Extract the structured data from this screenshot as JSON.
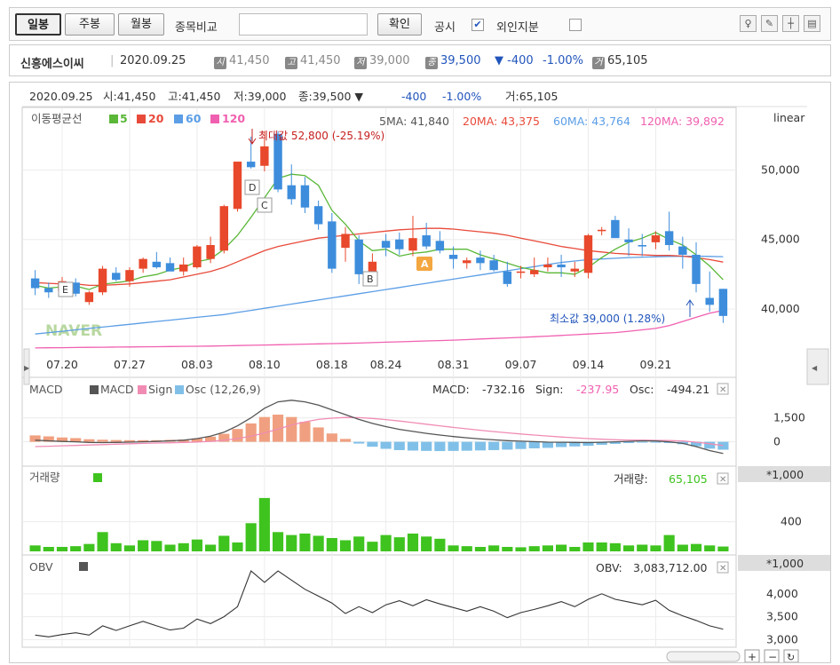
{
  "toolbar": {
    "tab_daily": "일봉",
    "tab_weekly": "주봉",
    "tab_monthly": "월봉",
    "compare_label": "종목비교",
    "confirm_button": "확인",
    "notice_label": "공시",
    "foreign_label": "외인지분",
    "notice_check": "✔"
  },
  "info_bar": {
    "name": "신흥에스이씨",
    "date": "2020.09.25",
    "open_icon": "시",
    "open": "41,450",
    "high_icon": "고",
    "high": "41,450",
    "low_icon": "저",
    "low": "39,000",
    "close_icon": "종",
    "close": "39,500",
    "change": "▼ -400",
    "change_pct": "-1.00%",
    "volume_icon": "거",
    "volume": "65,105"
  },
  "chart_header": {
    "date": "2020.09.25",
    "open": "시:41,450",
    "high": "고:41,450",
    "low": "저:39,000",
    "close": "종:39,500 ▼",
    "change": "-400",
    "change_pct": "-1.00%",
    "volume": "거:65,105"
  },
  "colors": {
    "up": "#e8482b",
    "down": "#3d8ddc",
    "ma5": "#5ab738",
    "ma20": "#e84a3a",
    "ma60": "#5b9ee6",
    "ma120": "#f060b0",
    "macd": "#555555",
    "signal": "#f08cb4",
    "osc_up": "#f0a080",
    "osc_down": "#80c0e8",
    "volume": "#3fc31f",
    "obv": "#333333"
  },
  "chart_data": [
    {
      "type": "candlestick",
      "legend_title": "이동평균선",
      "legend": [
        {
          "name": "5",
          "color": "#5ab738"
        },
        {
          "name": "20",
          "color": "#e84a3a"
        },
        {
          "name": "60",
          "color": "#5b9ee6"
        },
        {
          "name": "120",
          "color": "#f060b0"
        }
      ],
      "ma_values": {
        "ma5": "5MA: 41,840",
        "ma20": "20MA: 43,375",
        "ma60": "60MA: 43,764",
        "ma120": "120MA: 39,892"
      },
      "scale": "linear",
      "ylim": [
        37000,
        54500
      ],
      "y_ticks": [
        "50,000",
        "45,000",
        "40,000"
      ],
      "y_tick_values": [
        50000,
        45000,
        40000
      ],
      "x_ticks": [
        "07.20",
        "07.27",
        "08.03",
        "08.10",
        "08.18",
        "08.24",
        "08.31",
        "09.07",
        "09.14",
        "09.21"
      ],
      "x_tick_index": [
        2,
        7,
        12,
        17,
        22,
        26,
        31,
        36,
        41,
        46
      ],
      "max_label": "최대값 52,800 (-25.19%)",
      "min_label": "최소값 39,000 (1.28%)",
      "markers": [
        "E",
        "D",
        "C",
        "B",
        "A"
      ],
      "ohlc": [
        [
          42200,
          42800,
          41000,
          41500
        ],
        [
          41500,
          41900,
          40800,
          41200
        ],
        [
          41300,
          42300,
          41100,
          42000
        ],
        [
          41900,
          42200,
          40900,
          41100
        ],
        [
          40500,
          41300,
          40300,
          41200
        ],
        [
          41200,
          43100,
          41000,
          42900
        ],
        [
          42600,
          43000,
          42000,
          42100
        ],
        [
          42000,
          43000,
          41600,
          42800
        ],
        [
          42900,
          43700,
          42600,
          43600
        ],
        [
          43400,
          44100,
          42900,
          43000
        ],
        [
          43300,
          43700,
          42800,
          42700
        ],
        [
          42700,
          43700,
          42400,
          43200
        ],
        [
          43000,
          44600,
          42900,
          44500
        ],
        [
          43600,
          45200,
          43300,
          44600
        ],
        [
          44200,
          47500,
          44000,
          47400
        ],
        [
          47200,
          50600,
          47000,
          50600
        ],
        [
          50600,
          52400,
          50100,
          50200
        ],
        [
          50300,
          52800,
          49900,
          51700
        ],
        [
          52600,
          52800,
          48400,
          48600
        ],
        [
          48900,
          50400,
          47500,
          47900
        ],
        [
          48900,
          49500,
          46900,
          47300
        ],
        [
          47400,
          47800,
          45700,
          46100
        ],
        [
          46300,
          46900,
          42600,
          42900
        ],
        [
          44400,
          45900,
          43400,
          45400
        ],
        [
          45000,
          45300,
          41800,
          42500
        ],
        [
          42400,
          44000,
          42000,
          43400
        ],
        [
          44900,
          45400,
          43800,
          44400
        ],
        [
          45000,
          45500,
          43900,
          44300
        ],
        [
          44200,
          46700,
          43800,
          45100
        ],
        [
          45300,
          46200,
          44300,
          44500
        ],
        [
          44900,
          45600,
          44000,
          44200
        ],
        [
          43900,
          44500,
          42900,
          43600
        ],
        [
          43300,
          43700,
          42900,
          43500
        ],
        [
          43700,
          44200,
          42800,
          43300
        ],
        [
          43500,
          43900,
          42700,
          42800
        ],
        [
          42700,
          43400,
          41600,
          41800
        ],
        [
          42600,
          43100,
          42200,
          42700
        ],
        [
          42500,
          43700,
          42300,
          42800
        ],
        [
          43000,
          43700,
          42700,
          43200
        ],
        [
          43200,
          43900,
          42300,
          43000
        ],
        [
          42700,
          43400,
          42300,
          42900
        ],
        [
          42600,
          45400,
          42200,
          45300
        ],
        [
          45600,
          45900,
          45300,
          45700
        ],
        [
          46400,
          46700,
          45200,
          45100
        ],
        [
          45000,
          45800,
          43800,
          44800
        ],
        [
          44600,
          45400,
          43800,
          44500
        ],
        [
          44800,
          45600,
          44300,
          45300
        ],
        [
          45600,
          47000,
          44200,
          44600
        ],
        [
          44500,
          45200,
          42900,
          43900
        ],
        [
          43900,
          44800,
          41200,
          41800
        ],
        [
          40800,
          42700,
          39800,
          40300
        ],
        [
          41450,
          41450,
          39000,
          39500
        ]
      ],
      "ma5": [
        41700,
        41500,
        41600,
        41650,
        41400,
        41780,
        41900,
        42020,
        42320,
        42480,
        42800,
        43000,
        43400,
        43600,
        44300,
        45300,
        46600,
        48000,
        49400,
        49700,
        49600,
        48900,
        47100,
        46100,
        44900,
        44200,
        44300,
        43800,
        44000,
        44100,
        44300,
        44300,
        44300,
        43900,
        43600,
        43300,
        43000,
        42800,
        42600,
        42600,
        42500,
        43000,
        43700,
        44300,
        44800,
        45100,
        45500,
        45000,
        44600,
        43900,
        43100,
        42100
      ],
      "ma20": [
        41900,
        41850,
        41800,
        41800,
        41700,
        41700,
        41750,
        41800,
        41900,
        42000,
        42100,
        42300,
        42500,
        42700,
        43000,
        43400,
        43800,
        44200,
        44500,
        44700,
        44900,
        45100,
        45200,
        45300,
        45400,
        45500,
        45600,
        45700,
        45750,
        45800,
        45800,
        45750,
        45650,
        45550,
        45450,
        45300,
        45100,
        44900,
        44700,
        44500,
        44350,
        44200,
        44100,
        44000,
        43950,
        43900,
        43850,
        43850,
        43800,
        43700,
        43550,
        43375
      ],
      "ma60": [
        38200,
        38300,
        38400,
        38500,
        38600,
        38700,
        38800,
        38900,
        39000,
        39100,
        39200,
        39300,
        39400,
        39500,
        39600,
        39750,
        39900,
        40050,
        40200,
        40350,
        40500,
        40650,
        40800,
        40950,
        41100,
        41250,
        41400,
        41550,
        41700,
        41850,
        42000,
        42150,
        42300,
        42450,
        42600,
        42750,
        42900,
        43050,
        43200,
        43350,
        43450,
        43550,
        43600,
        43650,
        43700,
        43730,
        43760,
        43780,
        43790,
        43800,
        43780,
        43764
      ],
      "ma120": [
        37200,
        37210,
        37220,
        37230,
        37240,
        37250,
        37260,
        37270,
        37280,
        37290,
        37300,
        37310,
        37320,
        37330,
        37350,
        37370,
        37390,
        37410,
        37430,
        37450,
        37470,
        37490,
        37510,
        37530,
        37550,
        37580,
        37610,
        37640,
        37670,
        37700,
        37730,
        37760,
        37800,
        37840,
        37880,
        37920,
        37960,
        38000,
        38050,
        38100,
        38150,
        38200,
        38250,
        38300,
        38400,
        38500,
        38600,
        38800,
        39100,
        39400,
        39700,
        39892
      ]
    },
    {
      "type": "macd",
      "title": "MACD",
      "legend": [
        "MACD",
        "Sign",
        "Osc (12,26,9)"
      ],
      "readout": {
        "macd_label": "MACD:",
        "macd": "-732.16",
        "sign_label": "Sign:",
        "sign": "-237.95",
        "osc_label": "Osc:",
        "osc": "-494.21"
      },
      "y_ticks": [
        "1,500",
        "0"
      ],
      "y_tick_values": [
        1500,
        0
      ],
      "ylim": [
        -1300,
        3700
      ],
      "macd": [
        100,
        60,
        20,
        0,
        -40,
        -50,
        -40,
        -20,
        0,
        20,
        60,
        100,
        200,
        350,
        600,
        1000,
        1500,
        2100,
        2500,
        2600,
        2500,
        2300,
        2000,
        1700,
        1400,
        1150,
        950,
        780,
        650,
        530,
        420,
        330,
        250,
        180,
        120,
        70,
        40,
        10,
        -20,
        -30,
        -40,
        -50,
        -30,
        0,
        30,
        60,
        50,
        0,
        -100,
        -300,
        -550,
        -732
      ],
      "signal": [
        -300,
        -280,
        -250,
        -230,
        -200,
        -180,
        -150,
        -120,
        -100,
        -80,
        -60,
        -40,
        -10,
        30,
        100,
        200,
        350,
        550,
        800,
        1050,
        1250,
        1400,
        1480,
        1520,
        1510,
        1460,
        1390,
        1300,
        1200,
        1100,
        1000,
        900,
        810,
        720,
        640,
        560,
        490,
        420,
        360,
        300,
        250,
        200,
        160,
        130,
        110,
        100,
        90,
        80,
        50,
        -20,
        -120,
        -238
      ]
    },
    {
      "type": "bar",
      "title": "거래량",
      "readout_label": "거래량:",
      "readout": "65,105",
      "unit_label": "*1,000",
      "y_ticks": [
        "400"
      ],
      "y_tick_values": [
        400
      ],
      "ylim": [
        0,
        1150
      ],
      "values": [
        80,
        60,
        60,
        70,
        100,
        260,
        110,
        80,
        150,
        140,
        90,
        110,
        160,
        90,
        210,
        120,
        380,
        720,
        260,
        220,
        240,
        210,
        180,
        150,
        200,
        130,
        220,
        190,
        240,
        200,
        170,
        80,
        70,
        60,
        80,
        60,
        55,
        70,
        80,
        90,
        60,
        120,
        120,
        110,
        80,
        90,
        80,
        220,
        90,
        100,
        80,
        65
      ]
    },
    {
      "type": "line",
      "title": "OBV",
      "readout_label": "OBV:",
      "readout": "3,083,712.00",
      "unit_label": "*1,000",
      "y_ticks": [
        "4,000",
        "3,500",
        "3,000"
      ],
      "y_tick_values": [
        4000,
        3500,
        3000
      ],
      "ylim": [
        2950,
        4850
      ],
      "values": [
        3100,
        3060,
        3110,
        3150,
        3100,
        3300,
        3200,
        3300,
        3400,
        3300,
        3210,
        3250,
        3450,
        3350,
        3500,
        3720,
        4500,
        4250,
        4500,
        4300,
        4100,
        3950,
        3800,
        3570,
        3720,
        3590,
        3760,
        3850,
        3740,
        3870,
        3780,
        3700,
        3620,
        3720,
        3620,
        3480,
        3590,
        3660,
        3740,
        3830,
        3720,
        3880,
        4000,
        3880,
        3820,
        3760,
        3860,
        3640,
        3520,
        3420,
        3300,
        3230
      ]
    }
  ]
}
